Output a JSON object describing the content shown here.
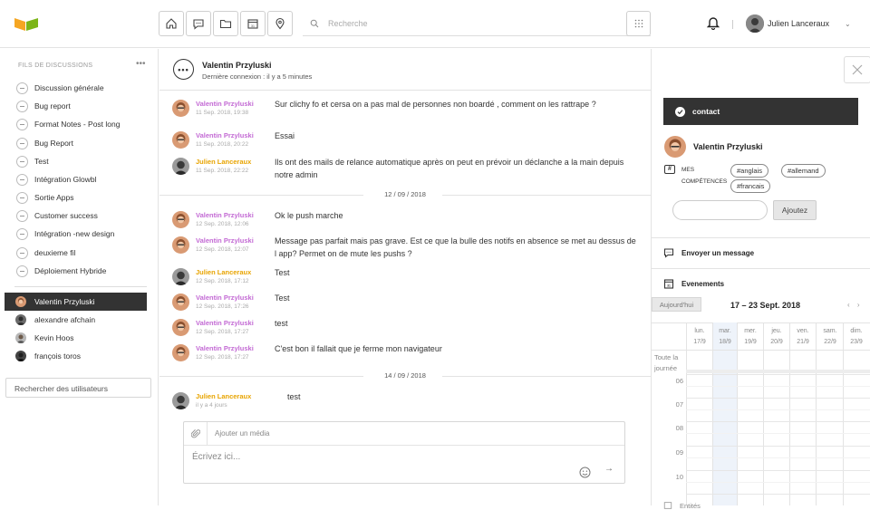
{
  "colors": {
    "accent_orange": "#f5a623",
    "accent_green": "#7cb518",
    "valentin": "#c36ad4",
    "julien": "#e8a400",
    "dark": "#333333"
  },
  "topbar": {
    "nav_icons": [
      "home-icon",
      "chat-icon",
      "folder-icon",
      "calendar-icon",
      "location-icon"
    ],
    "search_placeholder": "Recherche",
    "user_name": "Julien Lanceraux"
  },
  "sidebar": {
    "heading": "FILS DE DISCUSSIONS",
    "threads": [
      {
        "label": "Discussion générale"
      },
      {
        "label": "Bug report"
      },
      {
        "label": "Format Notes - Post long"
      },
      {
        "label": "Bug Report"
      },
      {
        "label": "Test"
      },
      {
        "label": "Intégration Glowbl"
      },
      {
        "label": "Sortie Apps"
      },
      {
        "label": "Customer success"
      },
      {
        "label": "Intégration -new design"
      },
      {
        "label": "deuxieme fil"
      },
      {
        "label": "Déploiement Hybride"
      }
    ],
    "people": [
      {
        "label": "Valentin Przyluski",
        "active": true
      },
      {
        "label": "alexandre afchain",
        "active": false
      },
      {
        "label": "Kevin Hoos",
        "active": false
      },
      {
        "label": "françois toros",
        "active": false
      }
    ],
    "user_search": "Rechercher des utilisateurs"
  },
  "chat": {
    "header_name": "Valentin Przyluski",
    "header_sub": "Dernière connexion : il y a 5 minutes",
    "messages": [
      {
        "author": "Valentin Przyluski",
        "date": "11 Sep. 2018, 19:38",
        "text": "Sur clichy fo et cersa on a pas mal de personnes non boardé , comment on les rattrape ?"
      },
      {
        "author": "Valentin Przyluski",
        "date": "11 Sep. 2018, 20:22",
        "text": "Essai"
      },
      {
        "author": "Julien Lanceraux",
        "date": "11 Sep. 2018, 22:22",
        "text": "Ils ont des mails de relance automatique après on peut en prévoir un déclanche a la main depuis notre admin"
      },
      {
        "author": "Valentin Przyluski",
        "date": "12 Sep. 2018, 12:06",
        "text": "Ok le push marche"
      },
      {
        "author": "Valentin Przyluski",
        "date": "12 Sep. 2018, 12:07",
        "text": "Message pas parfait mais pas grave. Est ce que la bulle des notifs en absence se met au dessus de l app? Permet on de mute les pushs ?"
      },
      {
        "author": "Julien Lanceraux",
        "date": "12 Sep. 2018, 17:12",
        "text": "Test"
      },
      {
        "author": "Valentin Przyluski",
        "date": "12 Sep. 2018, 17:26",
        "text": "Test"
      },
      {
        "author": "Valentin Przyluski",
        "date": "12 Sep. 2018, 17:27",
        "text": "test"
      },
      {
        "author": "Valentin Przyluski",
        "date": "12 Sep. 2018, 17:27",
        "text": "C'est bon il fallait que je ferme mon navigateur"
      },
      {
        "author": "Julien Lanceraux",
        "date": "il y a 4 jours",
        "text": "test"
      }
    ],
    "day_separators": [
      "12 / 09 / 2018",
      "14 / 09 / 2018"
    ],
    "composer": {
      "media_label": "Ajouter un média",
      "placeholder": "Écrivez ici..."
    }
  },
  "panel": {
    "contact_label": "contact",
    "person_name": "Valentin Przyluski",
    "competences_label": "MES COMPÉTENCES",
    "tags": [
      "#anglais",
      "#allemand",
      "#francais"
    ],
    "add_button": "Ajoutez",
    "send_message": "Envoyer un message",
    "events_label": "Evenements",
    "today_button": "Aujourd'hui",
    "week_title": "17 – 23 Sept. 2018",
    "week_nav": "‹ ›",
    "days": [
      {
        "name": "lun.",
        "num": "17/9"
      },
      {
        "name": "mar.",
        "num": "18/9"
      },
      {
        "name": "mer.",
        "num": "19/9"
      },
      {
        "name": "jeu.",
        "num": "20/9"
      },
      {
        "name": "ven.",
        "num": "21/9"
      },
      {
        "name": "sam.",
        "num": "22/9"
      },
      {
        "name": "dim.",
        "num": "23/9"
      }
    ],
    "allday_label": "Toute la journée",
    "hours": [
      "06",
      "07",
      "08",
      "09",
      "10"
    ],
    "entities_label": "Entités"
  }
}
